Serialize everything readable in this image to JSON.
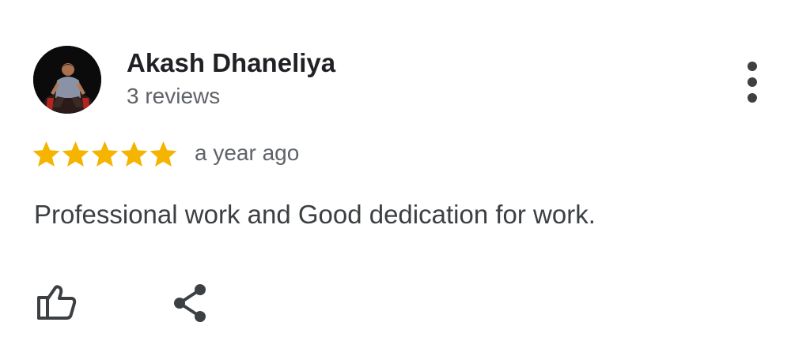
{
  "review": {
    "author": {
      "name": "Akash Dhaneliya",
      "reviews_count": "3 reviews"
    },
    "rating": {
      "stars": 5,
      "max_stars": 5,
      "star_color": "#f4b400"
    },
    "time_ago": "a year ago",
    "text": "Professional work and Good dedication for work."
  },
  "icons": {
    "more": "more-vertical-icon",
    "like": "thumbs-up-icon",
    "share": "share-icon"
  },
  "colors": {
    "name": "#202124",
    "secondary": "#5f6368",
    "body": "#3c4043",
    "icon": "#3c4043"
  }
}
